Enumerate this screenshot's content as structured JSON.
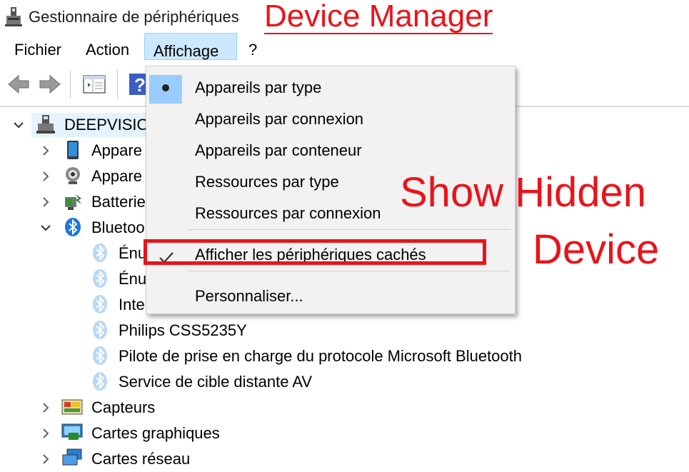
{
  "window": {
    "title": "Gestionnaire de périphériques"
  },
  "annotations": {
    "device_manager": "Device Manager",
    "show_hidden_line1": "Show Hidden",
    "show_hidden_line2": "Device",
    "color": "#e8141a"
  },
  "menubar": {
    "items": [
      {
        "label": "Fichier"
      },
      {
        "label": "Action"
      },
      {
        "label": "Affichage",
        "active": true
      },
      {
        "label": "?"
      }
    ]
  },
  "toolbar": {
    "buttons": [
      "back-arrow-icon",
      "forward-arrow-icon",
      "properties-icon",
      "help-icon"
    ]
  },
  "tree": {
    "root": {
      "label": "DEEPVISION",
      "expanded": true
    },
    "categories": [
      {
        "label": "Appare",
        "icon": "device-icon",
        "expanded": false
      },
      {
        "label": "Appare",
        "icon": "webcam-icon",
        "expanded": false
      },
      {
        "label": "Batterie",
        "icon": "battery-icon",
        "expanded": false
      },
      {
        "label": "Bluetoo",
        "icon": "bluetooth-icon",
        "expanded": true
      }
    ],
    "bluetooth_children": [
      {
        "label": "Énu"
      },
      {
        "label": "Énu"
      },
      {
        "label": "Inte"
      },
      {
        "label": "Philips CSS5235Y"
      },
      {
        "label": "Pilote de prise en charge du protocole Microsoft Bluetooth"
      },
      {
        "label": "Service de cible distante AV"
      }
    ],
    "after": [
      {
        "label": "Capteurs",
        "icon": "sensor-icon"
      },
      {
        "label": "Cartes graphiques",
        "icon": "display-adapter-icon"
      },
      {
        "label": "Cartes réseau",
        "icon": "network-adapter-icon"
      }
    ]
  },
  "dropdown": {
    "items": [
      {
        "label": "Appareils par type",
        "selected": true
      },
      {
        "label": "Appareils par connexion"
      },
      {
        "label": "Appareils par conteneur"
      },
      {
        "label": "Ressources par type"
      },
      {
        "label": "Ressources par connexion"
      },
      {
        "label": "Afficher les périphériques cachés",
        "checked": true
      },
      {
        "label": "Personnaliser..."
      }
    ]
  }
}
